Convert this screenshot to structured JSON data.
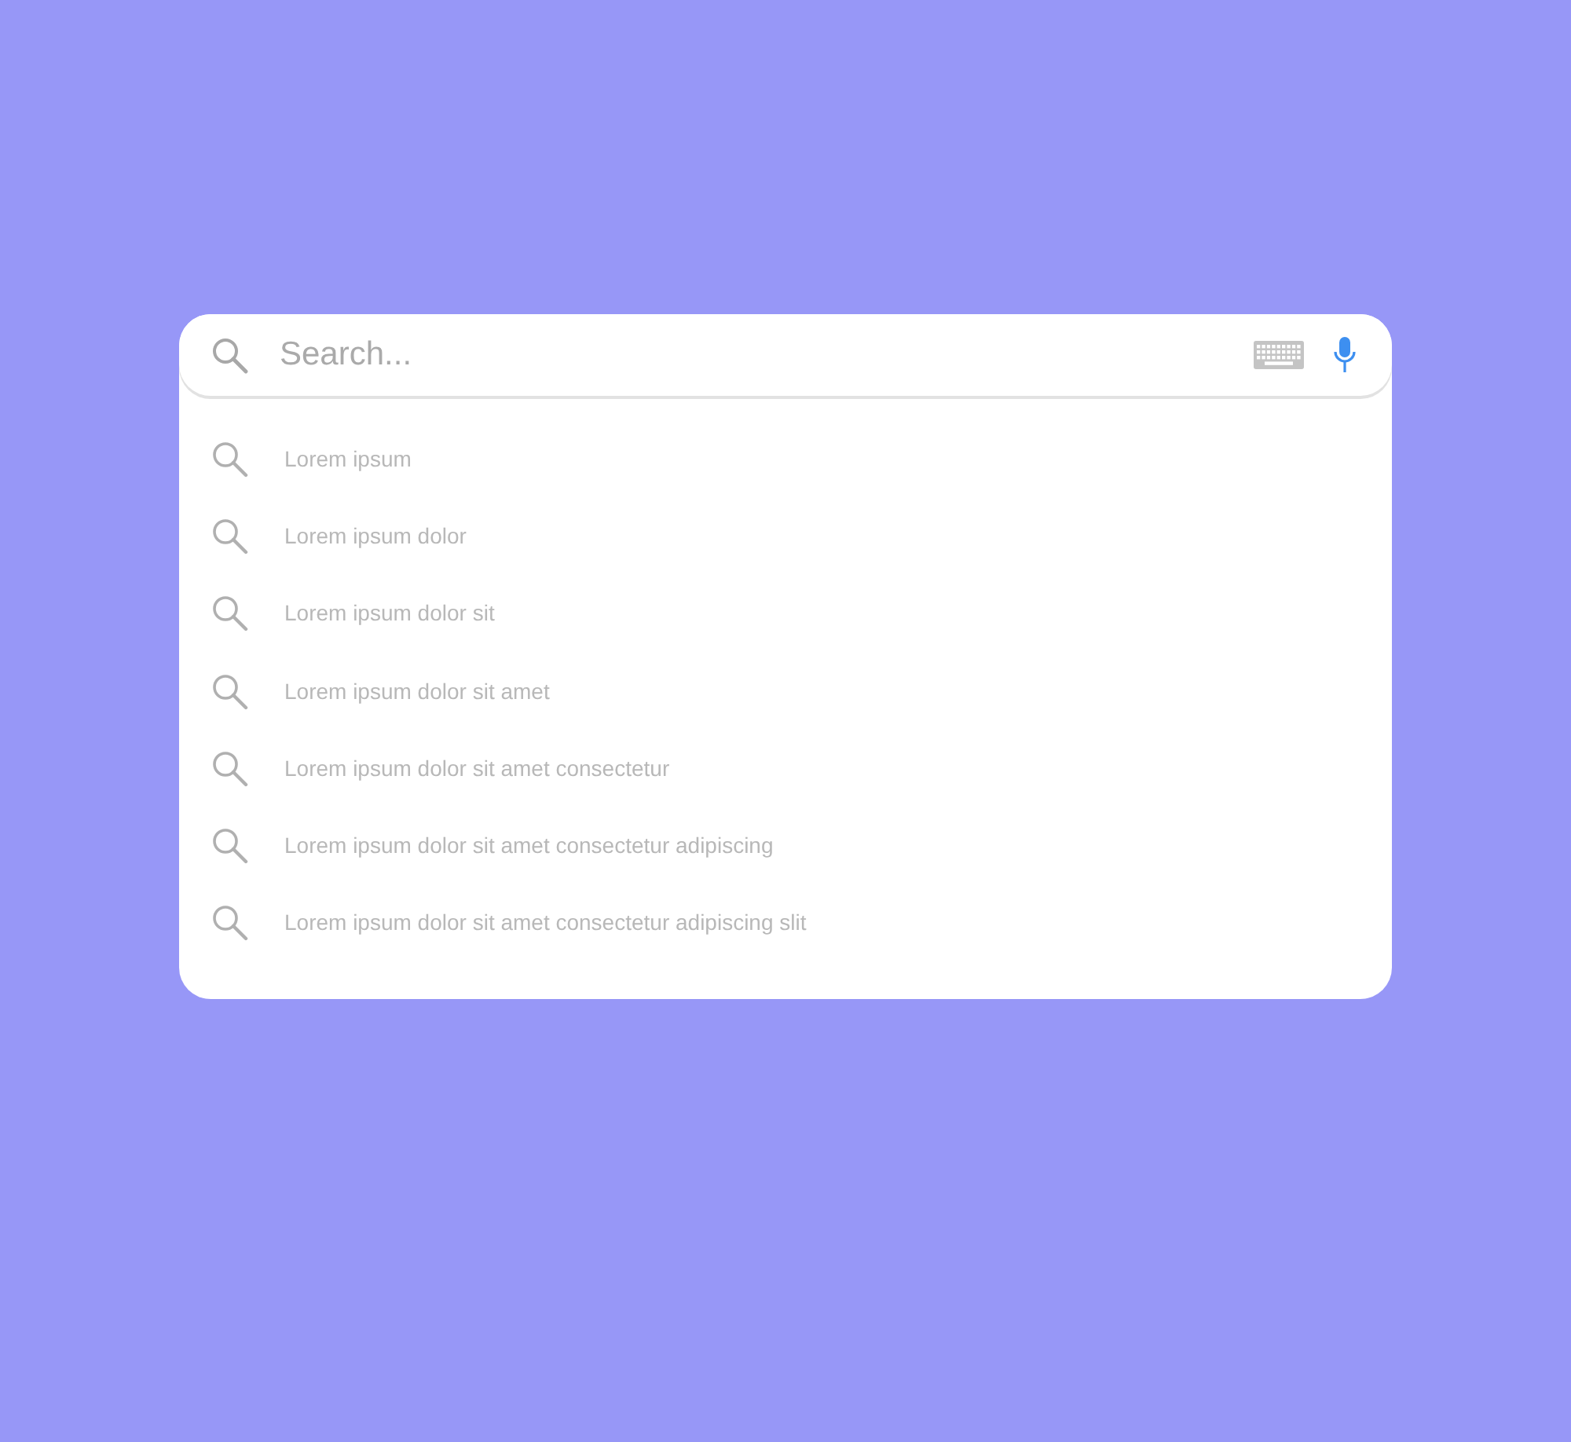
{
  "search": {
    "placeholder": "Search..."
  },
  "suggestions": [
    {
      "text": "Lorem ipsum"
    },
    {
      "text": "Lorem ipsum dolor"
    },
    {
      "text": "Lorem ipsum dolor sit"
    },
    {
      "text": "Lorem ipsum dolor sit amet"
    },
    {
      "text": "Lorem ipsum dolor sit amet consectetur"
    },
    {
      "text": "Lorem ipsum dolor sit amet consectetur adipiscing"
    },
    {
      "text": "Lorem ipsum dolor sit amet consectetur adipiscing slit"
    }
  ]
}
